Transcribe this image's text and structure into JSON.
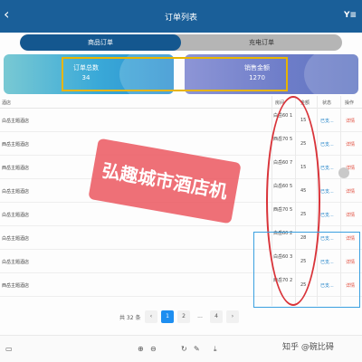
{
  "header": {
    "title": "订单列表",
    "back_icon": "chevron-left-icon",
    "filter_icon": "filter-icon",
    "filter_label": "Y≡"
  },
  "tabs": [
    {
      "label": "商品订单",
      "active": true
    },
    {
      "label": "充电订单",
      "active": false
    }
  ],
  "stats": [
    {
      "label": "订单总数",
      "value": "34"
    },
    {
      "label": "销售金额",
      "value": "1270"
    }
  ],
  "table": {
    "columns": [
      "酒店",
      "房间",
      "金额",
      "状态",
      "操作"
    ],
    "rows": [
      {
        "hotel": "白岳主题酒店",
        "room": "白岳60 1",
        "amount": "15",
        "status": "已支...",
        "action": "详情"
      },
      {
        "hotel": "西岳主题酒店",
        "room": "西岳70 5",
        "amount": "25",
        "status": "已支...",
        "action": "详情"
      },
      {
        "hotel": "西岳主题酒店",
        "room": "白岳60 7",
        "amount": "15",
        "status": "已支...",
        "action": "详情"
      },
      {
        "hotel": "白岳主题酒店",
        "room": "白岳60 5",
        "amount": "45",
        "status": "已支...",
        "action": "详情"
      },
      {
        "hotel": "白岳主题酒店",
        "room": "西岳70 5",
        "amount": "25",
        "status": "已支...",
        "action": "详情"
      },
      {
        "hotel": "白岳主题酒店",
        "room": "白岳60 2",
        "amount": "28",
        "status": "已支...",
        "action": "详情"
      },
      {
        "hotel": "白岳主题酒店",
        "room": "白岳60 3",
        "amount": "25",
        "status": "已支...",
        "action": "详情"
      },
      {
        "hotel": "西岳主题酒店",
        "room": "西岳70 2",
        "amount": "25",
        "status": "已支...",
        "action": "详情"
      }
    ]
  },
  "pagination": {
    "total": "共 32 条",
    "prev": "‹",
    "pages": [
      "1",
      "2",
      "...",
      "4"
    ],
    "current": "1",
    "next": "›"
  },
  "watermark": "弘趣城市酒店机",
  "toolbar": {
    "left_icon": "screen-icon",
    "zoom_in": "⊕",
    "zoom_out": "⊖",
    "rotate": "↻",
    "edit": "✎",
    "download": "⤓"
  },
  "zhihu": "知乎 @碗比碍",
  "colors": {
    "header": "#1a5f99",
    "active_tab": "#14578f",
    "status": "#1a7fc7",
    "action": "#e04a3a",
    "annotation_red": "#d9343a",
    "annotation_yellow": "#e8b400",
    "annotation_blue": "#3aa0e0"
  }
}
